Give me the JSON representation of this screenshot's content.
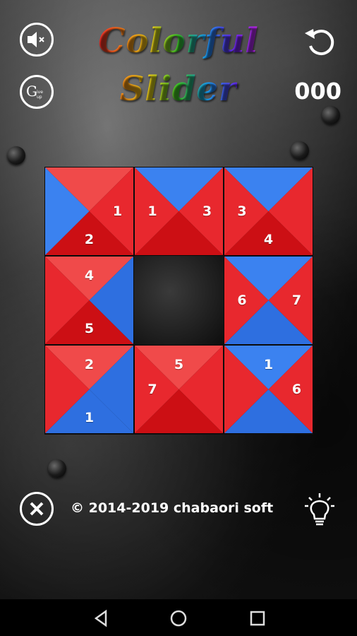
{
  "header": {
    "title_line1": "Colorful",
    "title_line2": "Slider",
    "move_count": "000"
  },
  "colors": {
    "red": "#e8282e",
    "red_dark": "#cc0f14",
    "red_light": "#f04a4a",
    "blue": "#2e6fe0",
    "blue_light": "#3b82f0"
  },
  "icons": {
    "mute": "speaker-muted-icon",
    "give_up": "give-up-icon",
    "restart": "restart-icon",
    "close": "close-icon",
    "hint": "lightbulb-icon"
  },
  "give_up_label": "G",
  "give_up_sub": "ive up",
  "board": {
    "tiles": [
      {
        "top": "red",
        "right": "red",
        "bottom": "red",
        "left": "blue",
        "n_right": "1",
        "n_bottom": "2",
        "n_top": "",
        "n_left": ""
      },
      {
        "top": "blue",
        "right": "red",
        "bottom": "red",
        "left": "red",
        "n_right": "3",
        "n_bottom": "",
        "n_top": "",
        "n_left": "1"
      },
      {
        "top": "blue",
        "right": "red",
        "bottom": "red",
        "left": "red",
        "n_right": "",
        "n_bottom": "4",
        "n_top": "",
        "n_left": "3"
      },
      {
        "top": "red",
        "right": "blue",
        "bottom": "red",
        "left": "red",
        "n_right": "",
        "n_bottom": "5",
        "n_top": "4",
        "n_left": ""
      },
      null,
      {
        "top": "blue",
        "right": "red",
        "bottom": "blue",
        "left": "red",
        "n_right": "7",
        "n_bottom": "",
        "n_top": "",
        "n_left": "6"
      },
      {
        "top": "red",
        "right": "blue",
        "bottom": "blue",
        "left": "red",
        "n_right": "",
        "n_bottom": "1",
        "n_top": "2",
        "n_left": ""
      },
      {
        "top": "red",
        "right": "red",
        "bottom": "red",
        "left": "red",
        "n_right": "",
        "n_bottom": "",
        "n_top": "5",
        "n_left": "7"
      },
      {
        "top": "blue",
        "right": "red",
        "bottom": "blue",
        "left": "red",
        "n_right": "6",
        "n_bottom": "",
        "n_top": "1",
        "n_left": ""
      }
    ]
  },
  "footer": {
    "copyright": "© 2014-2019 chabaori soft"
  }
}
